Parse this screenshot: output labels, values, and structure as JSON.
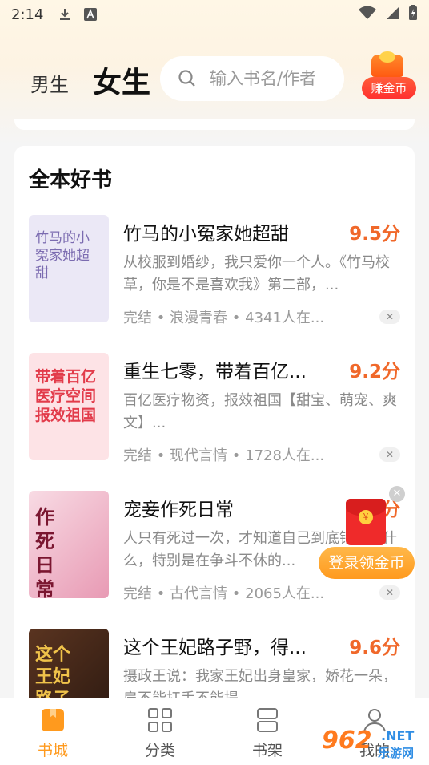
{
  "status_bar": {
    "time": "2:14"
  },
  "header": {
    "tab_male": "男生",
    "tab_female": "女生",
    "search_placeholder": "输入书名/作者",
    "coin_button": "赚金币"
  },
  "section": {
    "title": "全本好书",
    "books": [
      {
        "title": "竹马的小冤家她超甜",
        "score": "9.5分",
        "desc": "从校服到婚纱，我只爱你一个人。《竹马校草，你是不是喜欢我》第二部，...",
        "meta": "完结 • 浪漫青春 • 4341人在...",
        "cover_text": "竹马的小冤家她超甜",
        "cover_bg": "#ebe8f6",
        "cover_color": "#7b6bb0"
      },
      {
        "title": "重生七零，带着百亿...",
        "score": "9.2分",
        "desc": "百亿医疗物资，报效祖国【甜宝、萌宠、爽文】...",
        "meta": "完结 • 现代言情 • 1728人在...",
        "cover_text": "带着百亿医疗空间报效祖国",
        "cover_bg": "#fde3e6",
        "cover_color": "#e23b4a"
      },
      {
        "title": "宠妾作死日常",
        "score": "9.3分",
        "desc": "人只有死过一次，才知道自己到底错过了什么，特别是在争斗不休的...",
        "meta": "完结 • 古代言情 • 2065人在...",
        "cover_text": "作死日常",
        "cover_bg": "#f4c7d6",
        "cover_color": "#7a1630"
      },
      {
        "title": "这个王妃路子野，得...",
        "score": "9.6分",
        "desc": "摄政王说：我家王妃出身皇家，娇花一朵，肩不能扛手不能提...",
        "meta": "",
        "cover_text": "这个王妃路子野",
        "cover_bg": "#3a2418",
        "cover_color": "#f0c34a"
      }
    ]
  },
  "promo": {
    "label": "登录领金币",
    "coin_glyph": "¥"
  },
  "bottom_nav": {
    "items": [
      {
        "label": "书城",
        "icon": "bookstore-icon",
        "active": true
      },
      {
        "label": "分类",
        "icon": "category-grid-icon",
        "active": false
      },
      {
        "label": "书架",
        "icon": "bookshelf-icon",
        "active": false
      },
      {
        "label": "我的",
        "icon": "profile-icon",
        "active": false
      }
    ]
  },
  "watermark": {
    "number": "962",
    "net": ".NET",
    "cn": "乐游网"
  },
  "colors": {
    "accent": "#ff9a1e",
    "score": "#f0682a"
  }
}
